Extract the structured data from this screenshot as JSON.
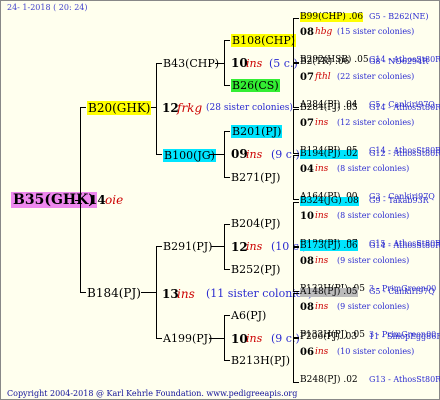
{
  "stamp": "24- 1-2018 ( 20: 24)",
  "root": "B35(GHK)",
  "g1": [
    {
      "name": "B20(GHK)",
      "year": "14",
      "sign": "oie"
    },
    {
      "name": "B184(PJ)",
      "year": "13",
      "sign": "ins",
      "note": "(11 sister colonies)"
    }
  ],
  "g2": [
    {
      "name": "B43(CHP)",
      "year": "12",
      "sign": "frkg",
      "note": "(28 sister colonies)"
    },
    {
      "name": "B100(JG)",
      "year": "09",
      "sign": "ins",
      "note": "(9 c.)"
    },
    {
      "name": "B291(PJ)",
      "year": "12",
      "sign": "ins",
      "note": "(10 c.)"
    },
    {
      "name": "A199(PJ)",
      "year": "10",
      "sign": "ins",
      "note": "(9 c.)"
    }
  ],
  "g3": [
    {
      "name": "B108(CHP)",
      "year": "10",
      "sign": "ins",
      "note": "(5 c.)"
    },
    {
      "name": "B26(CS)"
    },
    {
      "name": "B201(PJ)",
      "year": "07",
      "sign": "ins",
      "note": "(9 c.)"
    },
    {
      "name": "B271(PJ)"
    },
    {
      "name": "B204(PJ)",
      "year": "10",
      "sign": "ins",
      "note": "(9 c.)"
    },
    {
      "name": "B252(PJ)"
    },
    {
      "name": "A6(PJ)",
      "year": "10",
      "sign": "ins",
      "note": "(9 c.)"
    },
    {
      "name": "B213H(PJ)"
    }
  ],
  "g4": [
    {
      "name": "B99(CHP)",
      "num": ".06",
      "code": "G5 - B262(NE)",
      "year": "08",
      "sign": "hbg",
      "note": "(15 sister colonies)"
    },
    {
      "name": "B292(HSB)",
      "num": ".05",
      "code": "G14 - AthosSt80R"
    },
    {
      "name": "B2(TR)",
      "num": ".06",
      "code": "G8 - NO6294R",
      "year": "07",
      "sign": "fthl",
      "note": "(22 sister colonies)"
    },
    {
      "name": "A284(PJ)",
      "num": ".04",
      "code": "G5 - Cankiri97Q"
    },
    {
      "name": "B284(PJ)",
      "num": ".05",
      "code": "G14 - AthosSt80R",
      "year": "07",
      "sign": "ins",
      "note": "(12 sister colonies)"
    },
    {
      "name": "B124(PJ)",
      "num": ".05",
      "code": "G14 - AthosSt80R"
    },
    {
      "name": "B194(PJ)",
      "num": ".02",
      "code": "G12 - AthosSt80R",
      "year": "04",
      "sign": "ins",
      "note": "(8 sister colonies)"
    },
    {
      "name": "A164(PJ)",
      "num": ".00",
      "code": "G3 - Cankiri97Q"
    },
    {
      "name": "B324(JG)",
      "num": ".08",
      "code": "G9 - Takab93R",
      "year": "10",
      "sign": "ins",
      "note": "(8 sister colonies)"
    },
    {
      "name": "B129(PJ)",
      "num": ".07",
      "code": "G15 - AthosSt80R"
    },
    {
      "name": "B173(PJ)",
      "num": ".06",
      "code": "G14 - AthosSt80R",
      "year": "08",
      "sign": "ins",
      "note": "(9 sister colonies)"
    },
    {
      "name": "P133H(PJ)",
      "num": ".05",
      "code": "3 - PrimGreen00"
    },
    {
      "name": "A148(PJ)",
      "num": ".05",
      "code": "G5 - Cankiri97Q",
      "year": "08",
      "sign": "ins",
      "note": "(9 sister colonies)"
    },
    {
      "name": "P133H(PJ)",
      "num": ".05",
      "code": "3 - PrimGreen00"
    },
    {
      "name": "P206(PJ)",
      "num": ".03",
      "code": "11 - SinopEgg86R",
      "year": "06",
      "sign": "ins",
      "note": "(10 sister colonies)"
    },
    {
      "name": "B248(PJ)",
      "num": ".02",
      "code": "G13 - AthosSt80R"
    }
  ],
  "footer": "Copyright 2004-2018 @ Karl Kehrle Foundation.    www.pedigreeapis.org",
  "colors": {
    "yellow": "#ffff00",
    "cyan": "#00e5ff",
    "green": "#33ee33",
    "violet": "#ee88ee",
    "gray": "#bbbbbb",
    "red": "#cc0000",
    "blue": "#2b2bd0"
  }
}
